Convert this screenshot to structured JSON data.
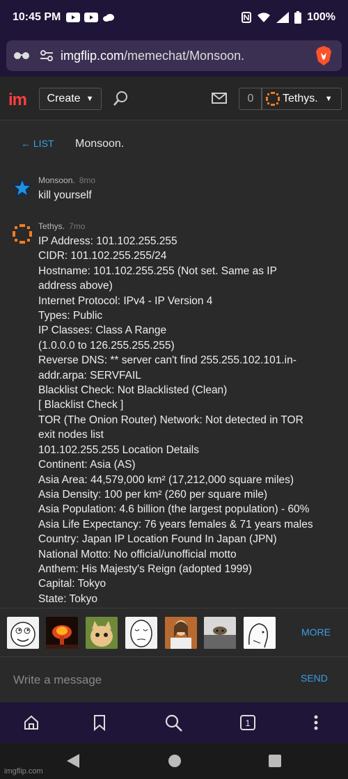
{
  "status": {
    "time": "10:45 PM",
    "battery": "100%"
  },
  "browser": {
    "url_domain": "imgflip.com",
    "url_path": "/memechat/Monsoon."
  },
  "site": {
    "logo": "im",
    "create_label": "Create",
    "notif_count": "0",
    "username": "Tethys."
  },
  "chat": {
    "back_label": "← LIST",
    "partner": "Monsoon.",
    "messages": [
      {
        "author": "Monsoon.",
        "ago": "8mo",
        "lines": [
          "kill yourself"
        ]
      },
      {
        "author": "Tethys.",
        "ago": "7mo",
        "lines": [
          "IP Address: 101.102.255.255",
          "CIDR: 101.102.255.255/24",
          "Hostname: 101.102.255.255 (Not set. Same as IP",
          "address above)",
          "Internet Protocol: IPv4 - IP Version 4",
          "Types: Public",
          "IP Classes: Class A Range",
          "(1.0.0.0 to 126.255.255.255)",
          "Reverse DNS: ** server can't find 255.255.102.101.in-",
          "addr.arpa: SERVFAIL",
          "Blacklist Check: Not Blacklisted (Clean)",
          "[ Blacklist Check ]",
          "TOR (The Onion Router) Network: Not detected in TOR",
          "exit nodes list",
          "101.102.255.255 Location Details",
          "Continent: Asia (AS)",
          "Asia Area: 44,579,000 km² (17,212,000 square miles)",
          "Asia Density: 100 per km² (260 per square mile)",
          "Asia Population: 4.6 billion (the largest population) - 60%",
          "Asia Life Expectancy: 76 years females & 71 years males",
          "Country: Japan IP Location Found In Japan (JPN)",
          "National Motto: No official/unofficial motto",
          "Anthem: His Majesty's Reign (adopted 1999)",
          "Capital: Tokyo",
          "State: Tokyo"
        ]
      }
    ]
  },
  "stickers": {
    "items": [
      "rage-face-sticker",
      "explosion-sticker",
      "cat-sticker",
      "okay-guy-sticker",
      "jesus-sticker",
      "cat-ceiling-sticker",
      "wojak-sticker"
    ],
    "more_label": "MORE"
  },
  "composer": {
    "placeholder": "Write a message",
    "send_label": "SEND"
  },
  "watermark": "imgflip.com",
  "colors": {
    "accent": "#39a0e5",
    "brand": "#ff3f3f",
    "browser_bar": "#1f1538"
  }
}
